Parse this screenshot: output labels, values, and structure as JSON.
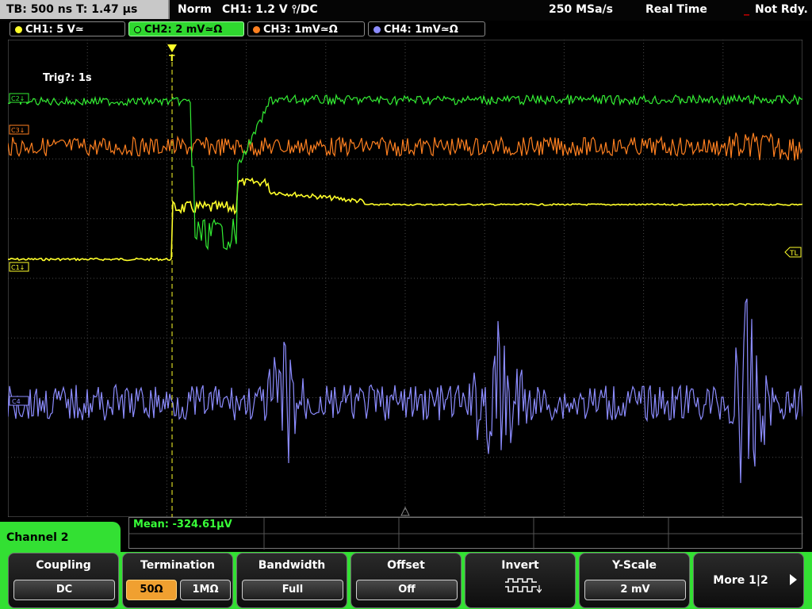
{
  "status": {
    "timebase": "TB: 500 ns   T: 1.47 µs",
    "acq_mode": "Norm",
    "trigger": "CH1: 1.2 V ⫯/DC",
    "sample_rate": "250 MSa/s",
    "time_mode": "Real Time",
    "ready": "Not Rdy."
  },
  "channels": [
    {
      "label": "CH1: 5 V≃",
      "color": "#ffff2a"
    },
    {
      "label": "CH2: 2 mV≃Ω",
      "color": "#33ee33"
    },
    {
      "label": "CH3: 1mV≃Ω",
      "color": "#ff8020"
    },
    {
      "label": "CH4: 1mV≃Ω",
      "color": "#8c8cff"
    }
  ],
  "screen": {
    "trigger_info": "Trig?: 1s",
    "trigger_marker": "T",
    "trigger_level_marker": "TL",
    "ch_markers": {
      "c1": "C1↓",
      "c2": "C2↓",
      "c3": "C3↓",
      "c4": "C4"
    }
  },
  "measurement": {
    "text": "Mean: -324.61µV"
  },
  "menu": {
    "title": "Channel 2",
    "softkeys": {
      "coupling": {
        "title": "Coupling",
        "value": "DC"
      },
      "termination": {
        "title": "Termination",
        "opt1": "50Ω",
        "opt2": "1MΩ"
      },
      "bandwidth": {
        "title": "Bandwidth",
        "value": "Full"
      },
      "offset": {
        "title": "Offset",
        "value": "Off"
      },
      "invert": {
        "title": "Invert"
      },
      "yscale": {
        "title": "Y-Scale",
        "value": "2 mV"
      },
      "more": {
        "label": "More 1|2"
      }
    }
  }
}
